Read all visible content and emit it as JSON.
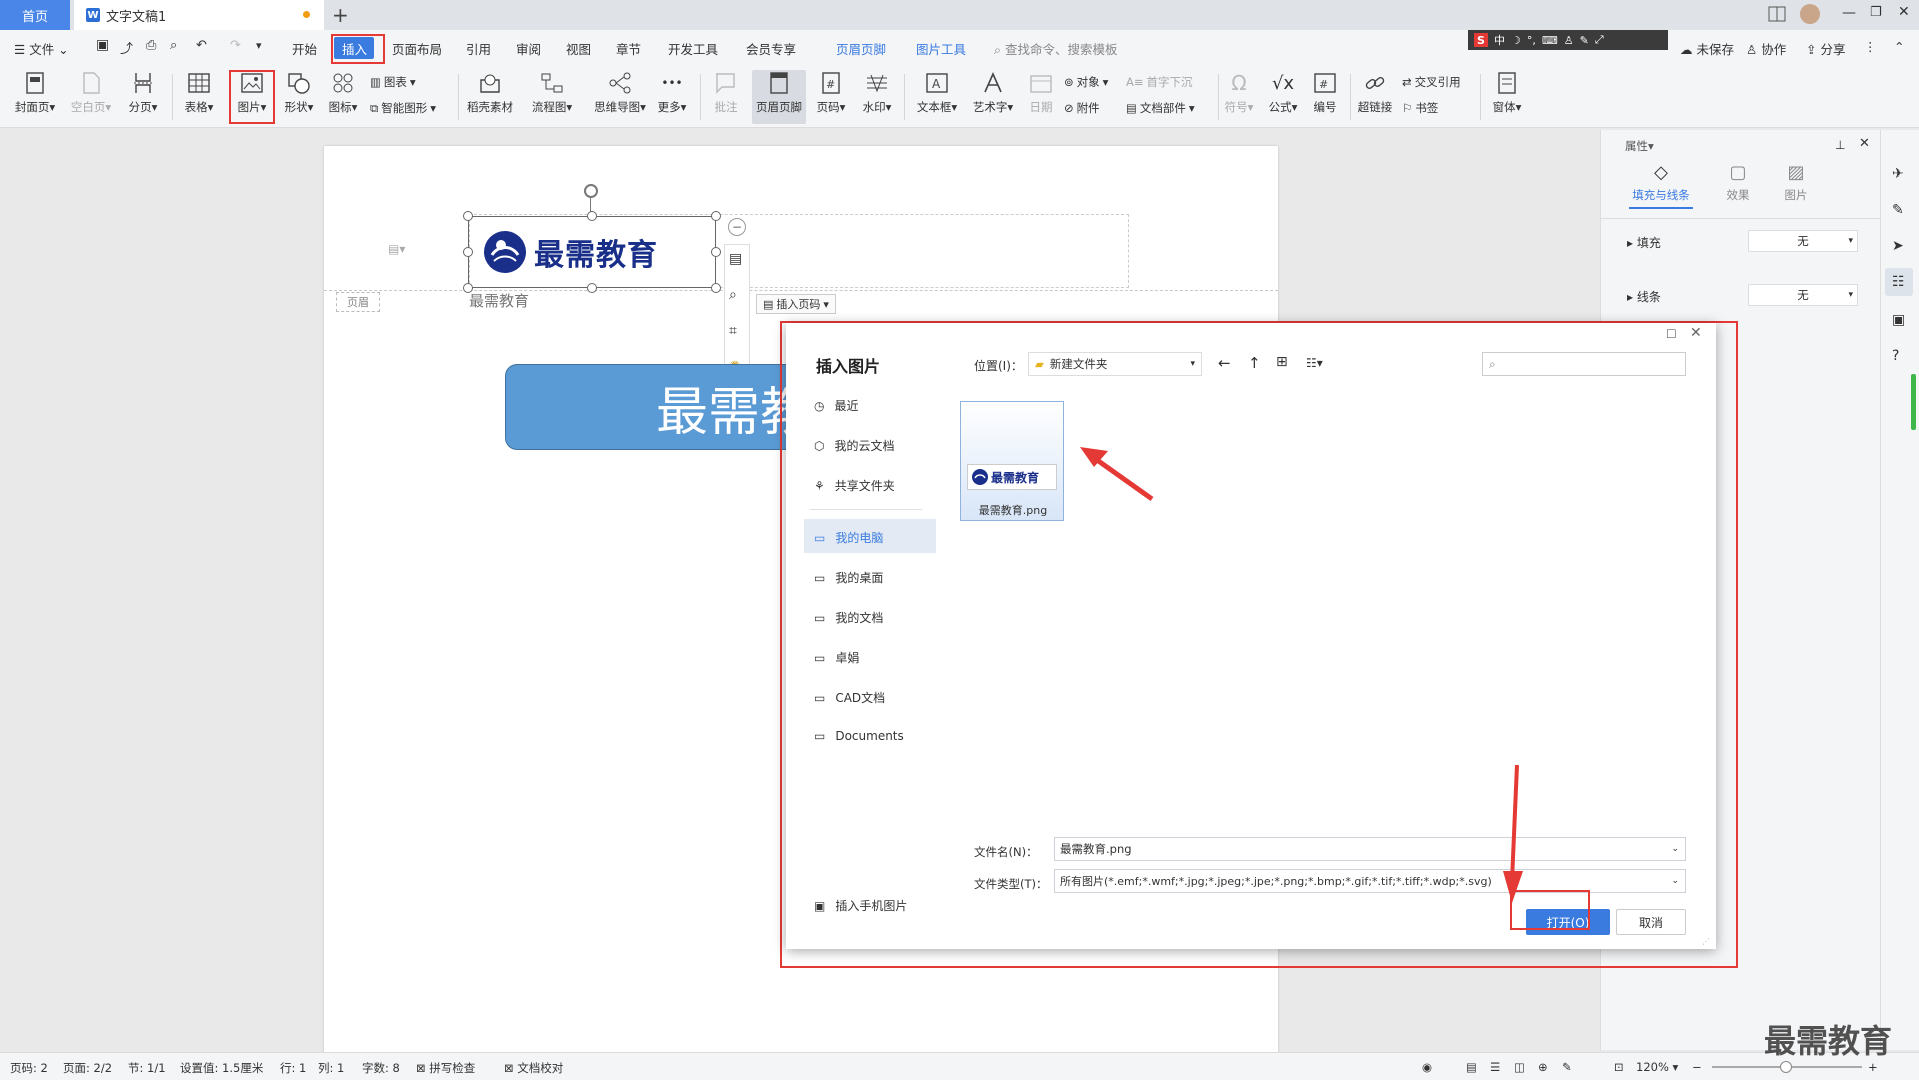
{
  "tabs": {
    "home": "首页",
    "doc": "文字文稿1"
  },
  "menu": {
    "file": "文件",
    "start": "开始",
    "insert": "插入",
    "layout": "页面布局",
    "reference": "引用",
    "review": "审阅",
    "view": "视图",
    "section": "章节",
    "devtools": "开发工具",
    "member": "会员专享",
    "header_footer": "页眉页脚",
    "picture_tools": "图片工具",
    "search_placeholder": "查找命令、搜索模板",
    "unsaved": "未保存",
    "collaborate": "协作",
    "share": "分享"
  },
  "ime": {
    "logo": "S",
    "lang": "中"
  },
  "ribbon": {
    "cover": "封面页",
    "blank": "空白页",
    "pagebreak": "分页",
    "table": "表格",
    "picture": "图片",
    "shape": "形状",
    "icon": "图标",
    "chart": "图表",
    "smartart": "智能图形",
    "daoke": "稻壳素材",
    "flowchart": "流程图",
    "mindmap": "思维导图",
    "more": "更多",
    "comment": "批注",
    "headerfooter": "页眉页脚",
    "pagenum": "页码",
    "watermark": "水印",
    "textbox": "文本框",
    "wordart": "艺术字",
    "date": "日期",
    "object": "对象",
    "attachment": "附件",
    "dropcap": "首字下沉",
    "docpart": "文档部件",
    "symbol": "符号",
    "formula": "公式",
    "numbering": "编号",
    "hyperlink": "超链接",
    "crossref": "交叉引用",
    "bookmark": "书签",
    "window": "窗体"
  },
  "document": {
    "header_label": "页眉",
    "header_text": "最需教育",
    "logo_text": "最需教育",
    "insert_pagenum": "插入页码",
    "banner_text": "最需教育"
  },
  "panel": {
    "title": "属性",
    "tab_fill": "填充与线条",
    "tab_effect": "效果",
    "tab_picture": "图片",
    "fill_label": "填充",
    "fill_value": "无",
    "line_label": "线条",
    "line_value": "无"
  },
  "dialog": {
    "title": "插入图片",
    "location_label": "位置(I)：",
    "location_value": "新建文件夹",
    "side": {
      "recent": "最近",
      "cloud": "我的云文档",
      "shared": "共享文件夹",
      "mypc": "我的电脑",
      "desktop": "我的桌面",
      "mydocs": "我的文档",
      "zhuoyu": "卓娟",
      "cad": "CAD文档",
      "documents": "Documents",
      "phone": "插入手机图片"
    },
    "file_name": "最需教育.png",
    "file_thumb_text": "最需教育",
    "filename_label": "文件名(N)：",
    "filename_value": "最需教育.png",
    "filetype_label": "文件类型(T)：",
    "filetype_value": "所有图片(*.emf;*.wmf;*.jpg;*.jpeg;*.jpe;*.png;*.bmp;*.gif;*.tif;*.tiff;*.wdp;*.svg)",
    "open": "打开(O)",
    "cancel": "取消"
  },
  "status": {
    "page": "页码: 2",
    "pages": "页面: 2/2",
    "section": "节: 1/1",
    "setting": "设置值: 1.5厘米",
    "row": "行: 1",
    "col": "列: 1",
    "words": "字数: 8",
    "spell": "拼写检查",
    "proof": "文档校对",
    "zoom": "120%"
  },
  "watermark_text": "最需教育",
  "colors": {
    "accent": "#3a7be0",
    "highlight": "#e53935",
    "banner": "#5b9bd5",
    "logo": "#1a2f8a"
  }
}
